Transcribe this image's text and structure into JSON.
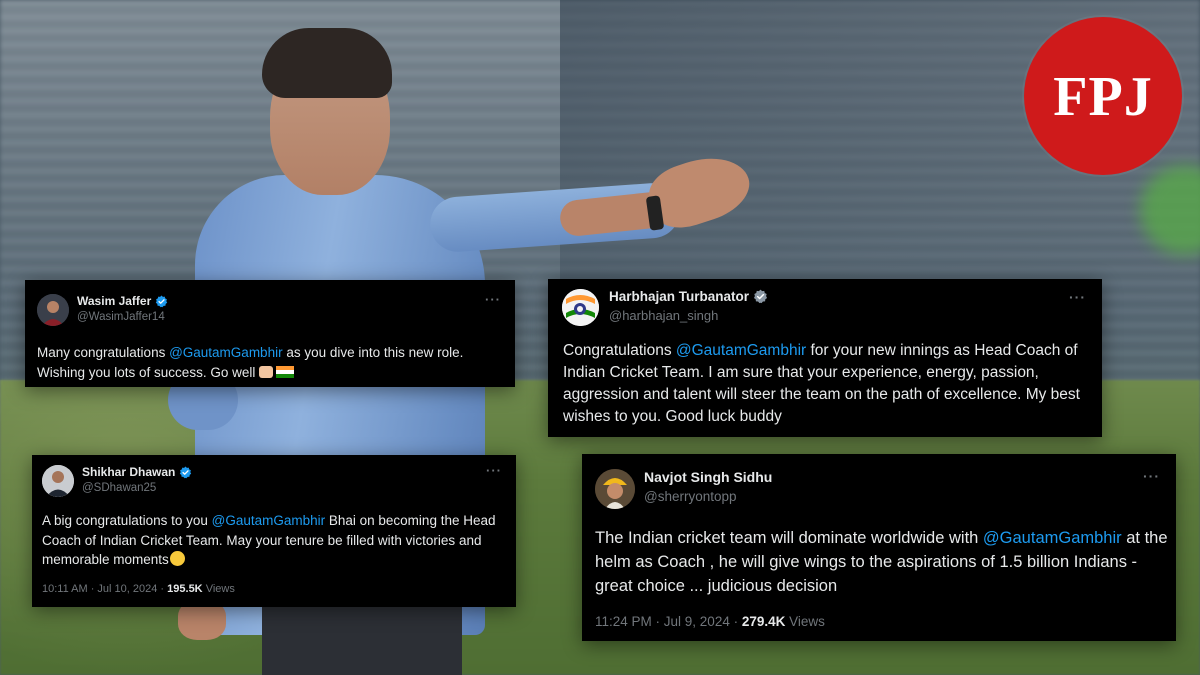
{
  "logo": {
    "text": "FPJ",
    "color": "#cf1a1b"
  },
  "tweets": [
    {
      "name": "Wasim Jaffer",
      "handle": "@WasimJaffer14",
      "verified": true,
      "more": "···",
      "text_pre": "Many congratulations ",
      "mention": "@GautamGambhir",
      "text_post": " as you dive into this new role. Wishing you lots of success. Go well",
      "emoji": [
        "fist-bump-icon",
        "india-flag-icon"
      ]
    },
    {
      "name": "Harbhajan Turbanator",
      "handle": "@harbhajan_singh",
      "verified": true,
      "more": "···",
      "text_pre": "Congratulations ",
      "mention": "@GautamGambhir",
      "text_post": " for your new innings as Head Coach of Indian Cricket Team. I am sure that your experience,  energy,  passion, aggression and talent will steer the team on the path of excellence.  My best wishes to you. Good luck buddy"
    },
    {
      "name": "Shikhar Dhawan",
      "handle": "@SDhawan25",
      "verified": true,
      "more": "···",
      "text_pre": "A big congratulations to you  ",
      "mention": "@GautamGambhir",
      "text_post": " Bhai on becoming the Head Coach of Indian Cricket Team. May your tenure be filled with victories and memorable moments",
      "emoji": [
        "hugging-face-icon"
      ],
      "timestamp": "10:11 AM · Jul 10, 2024 · ",
      "views_count": "195.5K",
      "views_label": " Views"
    },
    {
      "name": "Navjot Singh Sidhu",
      "handle": "@sherryontopp",
      "verified": false,
      "more": "···",
      "text_pre": "The Indian cricket team will dominate worldwide with ",
      "mention": "@GautamGambhir",
      "text_post": " at the helm as Coach , he will give wings to the aspirations of 1.5 billion Indians - great choice ... judicious decision",
      "timestamp": "11:24 PM · Jul 9, 2024 · ",
      "views_count": "279.4K",
      "views_label": " Views"
    }
  ],
  "colors": {
    "card_bg": "#000000",
    "text": "#e7e9ea",
    "muted": "#71767b",
    "mention": "#1d9bf0",
    "verified": "#1d9bf0"
  }
}
